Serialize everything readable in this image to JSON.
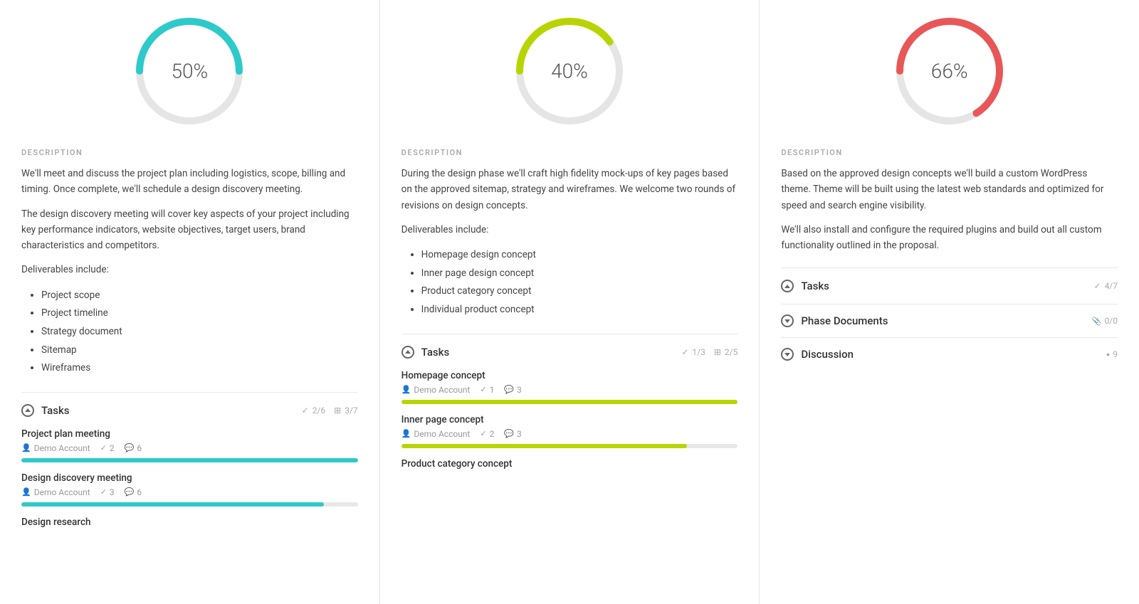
{
  "columns": [
    {
      "id": "col1",
      "percent": "50%",
      "donut_color": "#2ecaca",
      "donut_value": 50,
      "description_label": "DESCRIPTION",
      "description_paragraphs": [
        "We'll meet and discuss the project plan including logistics, scope, billing and timing. Once complete, we'll schedule a design discovery meeting.",
        "The design discovery meeting will cover key aspects of your project including key performance indicators, website objectives, target users, brand characteristics and competitors.",
        "Deliverables include:"
      ],
      "deliverables": [
        "Project scope",
        "Project timeline",
        "Strategy document",
        "Sitemap",
        "Wireframes"
      ],
      "tasks_label": "Tasks",
      "tasks_count": "2/6",
      "tasks_files": "3/7",
      "tasks": [
        {
          "name": "Project plan meeting",
          "assignee": "Demo Account",
          "checks": "2",
          "comments": "6",
          "progress": 100,
          "bar_color": "#2ecaca"
        },
        {
          "name": "Design discovery meeting",
          "assignee": "Demo Account",
          "checks": "3",
          "comments": "6",
          "progress": 90,
          "bar_color": "#2ecaca"
        },
        {
          "name": "Design research",
          "assignee": "",
          "checks": "",
          "comments": "",
          "progress": 0,
          "bar_color": "#2ecaca"
        }
      ]
    },
    {
      "id": "col2",
      "percent": "40%",
      "donut_color": "#b8d400",
      "donut_value": 40,
      "description_label": "DESCRIPTION",
      "description_paragraphs": [
        "During the design phase we'll craft high fidelity mock-ups of key pages based on the approved sitemap, strategy and wireframes. We welcome two rounds of revisions on design concepts.",
        "Deliverables include:"
      ],
      "deliverables": [
        "Homepage design concept",
        "Inner page design concept",
        "Product category concept",
        "Individual product concept"
      ],
      "tasks_label": "Tasks",
      "tasks_count": "1/3",
      "tasks_files": "2/5",
      "tasks": [
        {
          "name": "Homepage concept",
          "assignee": "Demo Account",
          "checks": "1",
          "comments": "3",
          "progress": 100,
          "bar_color": "#b8d400"
        },
        {
          "name": "Inner page concept",
          "assignee": "Demo Account",
          "checks": "2",
          "comments": "3",
          "progress": 85,
          "bar_color": "#b8d400"
        },
        {
          "name": "Product category concept",
          "assignee": "",
          "checks": "",
          "comments": "",
          "progress": 0,
          "bar_color": "#b8d400"
        }
      ]
    },
    {
      "id": "col3",
      "percent": "66%",
      "donut_color": "#e85757",
      "donut_value": 66,
      "description_label": "DESCRIPTION",
      "description_paragraphs": [
        "Based on the approved design concepts we'll build a custom WordPress theme. Theme will be built using the latest web standards and optimized for speed and search engine visibility.",
        "We'll also install and configure the required plugins and build out all custom functionality outlined in the proposal."
      ],
      "deliverables": [],
      "tasks_label": "Tasks",
      "tasks_count": "4/7",
      "tasks_files": "",
      "tasks": [],
      "phase_docs_label": "Phase Documents",
      "phase_docs_count": "0/0",
      "discussion_label": "Discussion",
      "discussion_count": "9"
    }
  ]
}
